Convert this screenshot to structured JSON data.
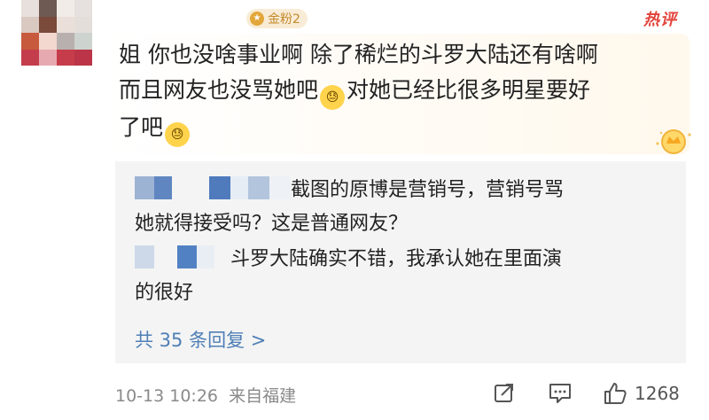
{
  "header": {
    "fan_badge": "金粉2",
    "hot_label": "热评"
  },
  "comment": {
    "lines": [
      "姐 你也没啥事业啊 除了稀烂的斗罗大陆还有啥啊",
      "而且网友也没骂她吧",
      "对她已经比很多明星要好",
      "了吧"
    ]
  },
  "replies": [
    {
      "text_lines": [
        "截图的原博是营销号，营销号骂",
        "她就得接受吗？这是普通网友？"
      ]
    },
    {
      "text_lines": [
        "斗罗大陆确实不错，我承认她在里面演",
        "的很好"
      ]
    }
  ],
  "more_replies": "共 35 条回复 >",
  "footer": {
    "timestamp": "10-13 10:26",
    "location": "来自福建",
    "like_count": "1268"
  },
  "icons": [
    "share-icon",
    "comment-icon",
    "like-icon",
    "crown-icon",
    "tear-emoji"
  ],
  "colors": {
    "link": "#4f7fb6",
    "hot": "#e2433b",
    "badge": "#c48a2c",
    "reply_bg": "#f4f4f4"
  }
}
